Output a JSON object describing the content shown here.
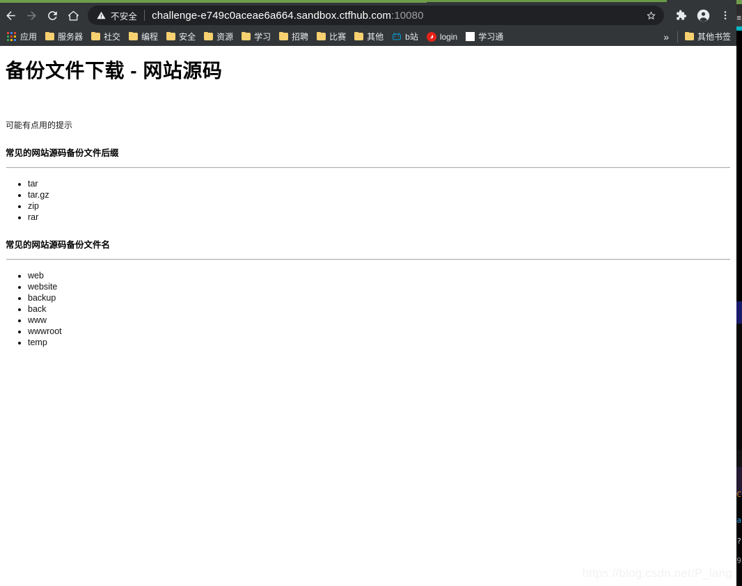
{
  "browser": {
    "nav": {
      "back": "back-arrow",
      "forward": "forward-arrow",
      "reload": "reload-icon",
      "home": "home-icon"
    },
    "omnibox": {
      "security_label": "不安全",
      "security_icon": "warning-triangle-icon",
      "url_host": "challenge-e749c0aceae6a664.sandbox.ctfhub.com",
      "url_port": ":10080",
      "bookmark_icon": "star-icon"
    },
    "toolbar_icons": {
      "extensions": "puzzle-piece-icon",
      "profile": "account-avatar-icon",
      "menu": "three-dot-menu-icon"
    },
    "bookmarks": [
      {
        "label": "应用",
        "icon": "apps-grid-icon"
      },
      {
        "label": "服务器",
        "icon": "folder-icon"
      },
      {
        "label": "社交",
        "icon": "folder-icon"
      },
      {
        "label": "编程",
        "icon": "folder-icon"
      },
      {
        "label": "安全",
        "icon": "folder-icon"
      },
      {
        "label": "资源",
        "icon": "folder-icon"
      },
      {
        "label": "学习",
        "icon": "folder-icon"
      },
      {
        "label": "招聘",
        "icon": "folder-icon"
      },
      {
        "label": "比赛",
        "icon": "folder-icon"
      },
      {
        "label": "其他",
        "icon": "folder-icon"
      },
      {
        "label": "b站",
        "icon": "bilibili-icon"
      },
      {
        "label": "login",
        "icon": "login-icon"
      },
      {
        "label": "学习通",
        "icon": "white-square-icon"
      }
    ],
    "bookmarks_overflow": {
      "chevron": "»",
      "other_label": "其他书签",
      "other_icon": "folder-icon"
    }
  },
  "page": {
    "title": "备份文件下载 - 网站源码",
    "hint": "可能有点用的提示",
    "sections": [
      {
        "heading": "常见的网站源码备份文件后缀",
        "items": [
          "tar",
          "tar.gz",
          "zip",
          "rar"
        ]
      },
      {
        "heading": "常见的网站源码备份文件名",
        "items": [
          "web",
          "website",
          "backup",
          "back",
          "www",
          "wwwroot",
          "temp"
        ]
      }
    ],
    "watermark": "https://blog.csdn.net/P_lang"
  },
  "colors": {
    "chrome_toolbar": "#323639",
    "omnibox": "#202124",
    "tab_accent": "#6f9c4a",
    "folder": "#f7d070",
    "bilibili": "#00a1d6",
    "login_red": "#e2231a"
  }
}
